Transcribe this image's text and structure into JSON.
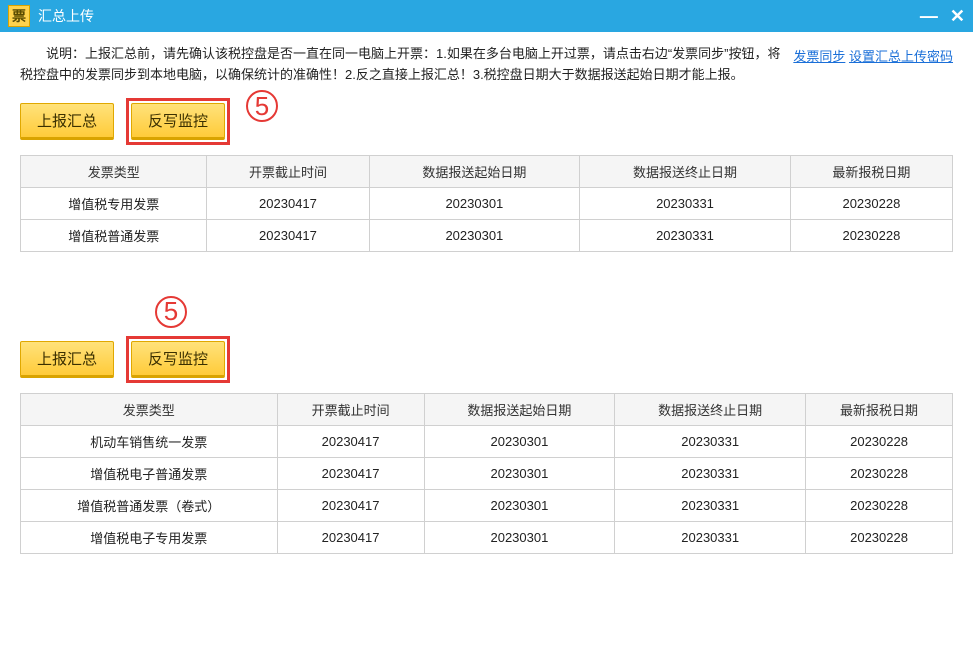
{
  "titlebar": {
    "icon_text": "票",
    "title": "汇总上传"
  },
  "instruction": {
    "text": "　　说明：上报汇总前，请先确认该税控盘是否一直在同一电脑上开票：1.如果在多台电脑上开过票，请点击右边“发票同步”按钮，将税控盘中的发票同步到本地电脑，以确保统计的准确性！2.反之直接上报汇总！3.税控盘日期大于数据报送起始日期才能上报。",
    "link_sync": "发票同步",
    "link_pwd": "设置汇总上传密码"
  },
  "buttons": {
    "upload": "上报汇总",
    "monitor": "反写监控"
  },
  "step_label": "5",
  "table_headers": {
    "c1": "发票类型",
    "c2": "开票截止时间",
    "c3": "数据报送起始日期",
    "c4": "数据报送终止日期",
    "c5": "最新报税日期"
  },
  "table1": [
    {
      "c1": "增值税专用发票",
      "c2": "20230417",
      "c3": "20230301",
      "c4": "20230331",
      "c5": "20230228"
    },
    {
      "c1": "增值税普通发票",
      "c2": "20230417",
      "c3": "20230301",
      "c4": "20230331",
      "c5": "20230228"
    }
  ],
  "table2": [
    {
      "c1": "机动车销售统一发票",
      "c2": "20230417",
      "c3": "20230301",
      "c4": "20230331",
      "c5": "20230228"
    },
    {
      "c1": "增值税电子普通发票",
      "c2": "20230417",
      "c3": "20230301",
      "c4": "20230331",
      "c5": "20230228"
    },
    {
      "c1": "增值税普通发票（卷式）",
      "c2": "20230417",
      "c3": "20230301",
      "c4": "20230331",
      "c5": "20230228"
    },
    {
      "c1": "增值税电子专用发票",
      "c2": "20230417",
      "c3": "20230301",
      "c4": "20230331",
      "c5": "20230228"
    }
  ]
}
